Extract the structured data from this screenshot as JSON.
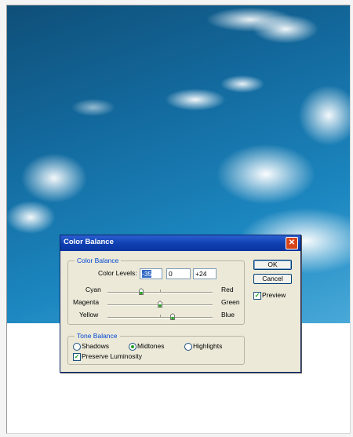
{
  "dialog": {
    "title": "Color Balance",
    "close_icon": "close-x-icon"
  },
  "color_balance": {
    "group_title": "Color Balance",
    "levels_label": "Color Levels:",
    "levels": [
      "-35",
      "0",
      "+24"
    ],
    "sliders": [
      {
        "left": "Cyan",
        "right": "Red",
        "value": -35
      },
      {
        "left": "Magenta",
        "right": "Green",
        "value": 0
      },
      {
        "left": "Yellow",
        "right": "Blue",
        "value": 24
      }
    ],
    "slider_range": [
      -100,
      100
    ]
  },
  "tone_balance": {
    "group_title": "Tone Balance",
    "options": [
      "Shadows",
      "Midtones",
      "Highlights"
    ],
    "selected": "Midtones",
    "preserve_label": "Preserve Luminosity",
    "preserve_checked": true
  },
  "buttons": {
    "ok": "OK",
    "cancel": "Cancel",
    "preview_label": "Preview",
    "preview_checked": true
  },
  "colors": {
    "title_bar": "#0f3fb0",
    "dialog_bg": "#ece9d8",
    "group_title": "#0046d5",
    "check_mark": "#21a121"
  }
}
